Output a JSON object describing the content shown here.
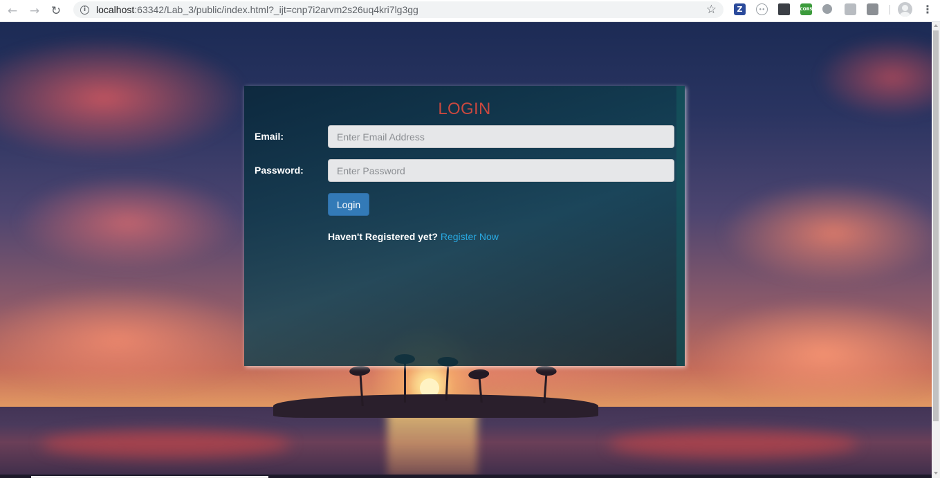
{
  "browser": {
    "url_host": "localhost",
    "url_rest": ":63342/Lab_3/public/index.html?_ijt=cnp7i2arvm2s26uq4kri7lg3gg",
    "icons": [
      "back-arrow-icon",
      "forward-arrow-icon",
      "reload-icon",
      "info-icon",
      "star-icon",
      "menu-icon"
    ],
    "extensions": {
      "z": "Z",
      "cors": "CORS"
    }
  },
  "login": {
    "title": "LOGIN",
    "email_label": "Email:",
    "email_placeholder": "Enter Email Address",
    "password_label": "Password:",
    "password_placeholder": "Enter Password",
    "login_button": "Login",
    "register_prompt": "Haven't Registered yet?",
    "register_link": "Register Now",
    "colors": {
      "title": "#c9483f",
      "button": "#337ab7",
      "link": "#29a8e0"
    }
  }
}
